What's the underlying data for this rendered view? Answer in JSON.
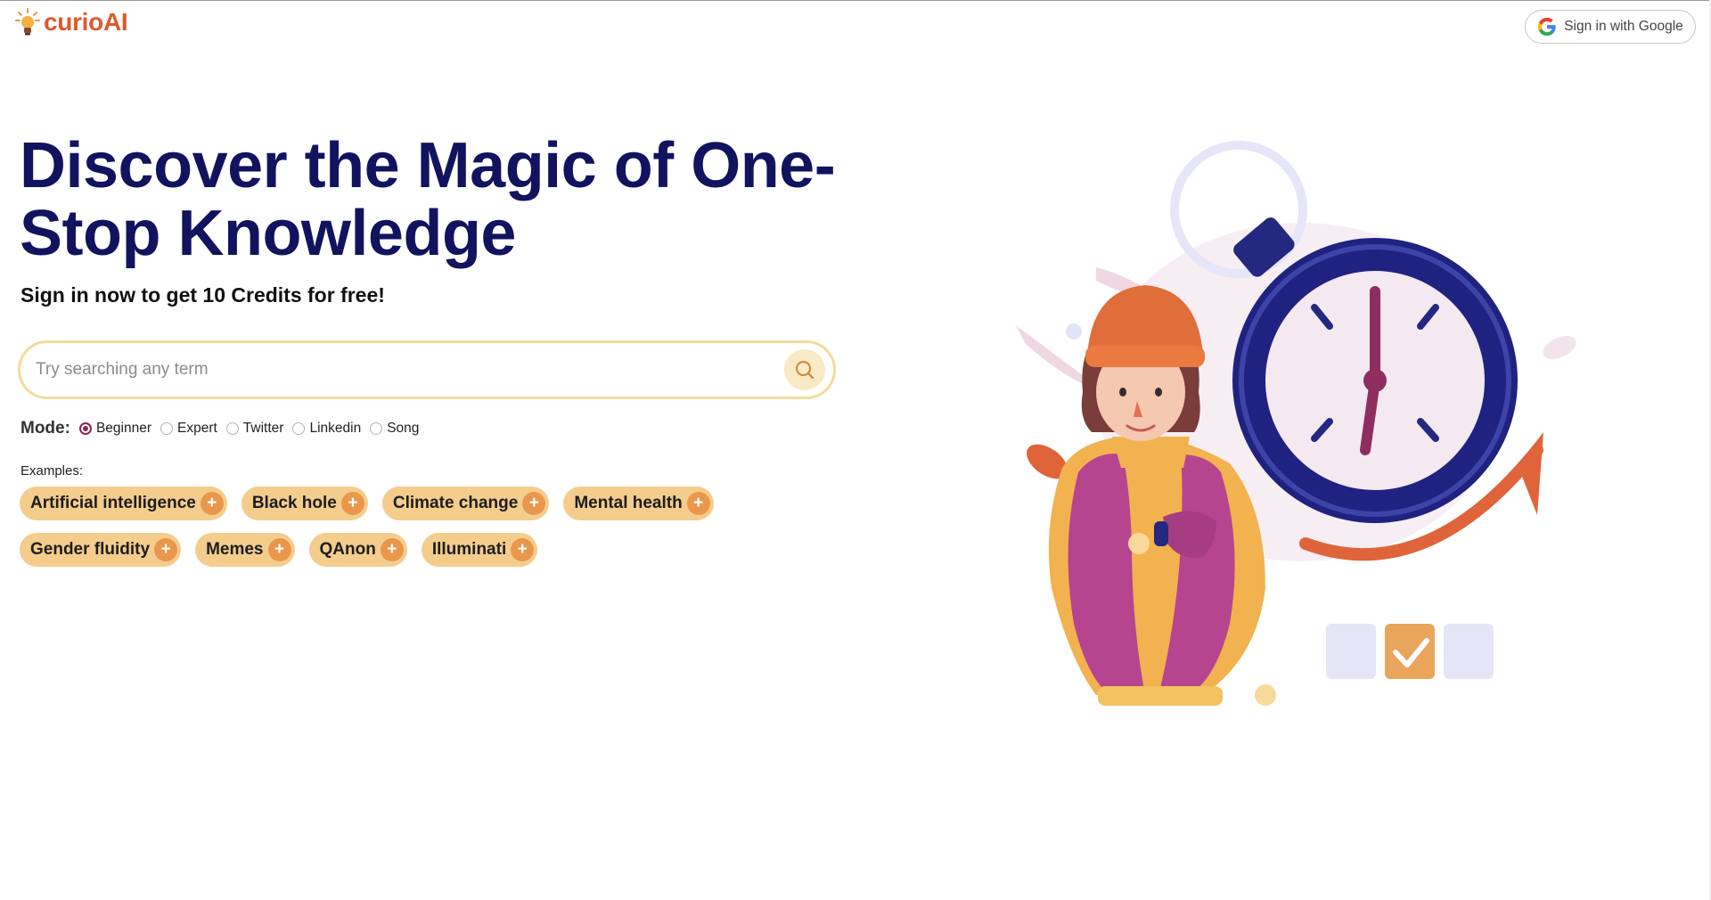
{
  "brand": {
    "name": "curioAI"
  },
  "header": {
    "google_signin_label": "Sign in with Google"
  },
  "hero": {
    "title": "Discover the Magic of One-Stop Knowledge",
    "subtitle": "Sign in now to get 10 Credits for free!"
  },
  "search": {
    "placeholder": "Try searching any term",
    "value": ""
  },
  "mode": {
    "label": "Mode:",
    "selected": "Beginner",
    "options": [
      "Beginner",
      "Expert",
      "Twitter",
      "Linkedin",
      "Song"
    ]
  },
  "examples": {
    "label": "Examples:",
    "rows": [
      [
        "Artificial intelligence",
        "Black hole",
        "Climate change",
        "Mental health"
      ],
      [
        "Gender fluidity",
        "Memes",
        "QAnon",
        "Illuminati"
      ]
    ]
  },
  "colors": {
    "title_navy": "#12135f",
    "brand_orange": "#dd5a2b",
    "chip_bg": "#f4cd8c",
    "chip_plus": "#e9974c",
    "search_border": "#f3dc9a",
    "radio_checked": "#8b2456"
  },
  "icons": {
    "logo": "lightbulb-icon",
    "google": "google-g-icon",
    "search": "search-icon",
    "chip_add": "plus-icon"
  }
}
